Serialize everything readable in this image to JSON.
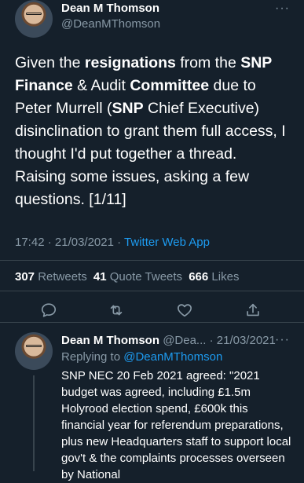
{
  "main_tweet": {
    "author_name": "Dean M Thomson",
    "author_handle": "@DeanMThomson",
    "more_icon": "more-dots-icon",
    "text_runs": [
      {
        "t": "Given the ",
        "bold": false
      },
      {
        "t": "resignations",
        "bold": true
      },
      {
        "t": " from the ",
        "bold": false
      },
      {
        "t": "SNP",
        "bold": true
      },
      {
        "t": " ",
        "bold": false
      },
      {
        "t": "Finance",
        "bold": true
      },
      {
        "t": " & Audit ",
        "bold": false
      },
      {
        "t": "Committee",
        "bold": true
      },
      {
        "t": " due to Peter Murrell (",
        "bold": false
      },
      {
        "t": "SNP",
        "bold": true
      },
      {
        "t": " Chief Executive) disinclination to grant them full access, I thought I'd put together a thread. Raising some issues, asking a few questions. [1/11]",
        "bold": false
      }
    ],
    "time": "17:42",
    "date": "21/03/2021",
    "separator": "·",
    "source": "Twitter Web App",
    "stats": {
      "retweets_count": "307",
      "retweets_label": "Retweets",
      "quotes_count": "41",
      "quotes_label": "Quote Tweets",
      "likes_count": "666",
      "likes_label": "Likes"
    },
    "actions": [
      "reply-icon",
      "retweet-icon",
      "like-icon",
      "share-icon"
    ]
  },
  "reply_tweet": {
    "author_name": "Dean M Thomson",
    "author_handle_trunc": "@Dea...",
    "date": "· 21/03/2021",
    "more_icon": "more-dots-icon",
    "replying_prefix": "Replying to ",
    "replying_handle": "@DeanMThomson",
    "text": "SNP NEC 20 Feb 2021 agreed: \"2021 budget was agreed, including £1.5m Holyrood election spend, £600k this financial year for referendum preparations, plus new Headquarters staff to support local gov't & the complaints processes overseen by National"
  },
  "colors": {
    "background": "#15202b",
    "text": "#ffffff",
    "muted": "#8899a6",
    "accent": "#1d9bf0",
    "divider": "#38444d"
  }
}
